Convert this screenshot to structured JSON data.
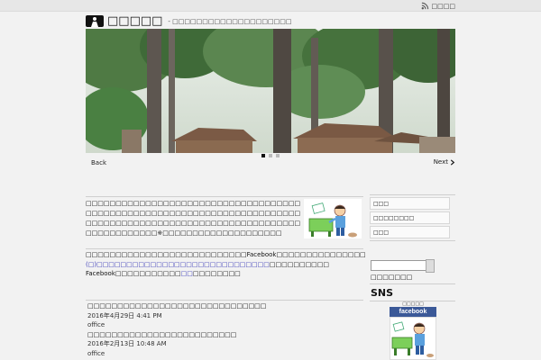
{
  "topbar": {
    "rss_label": "□□□□"
  },
  "header": {
    "site_title": "□□□□□",
    "tagline": "- □□□□□□□□□□□□□□□□□□□□"
  },
  "slider": {
    "back_label": "Back",
    "next_label": "Next",
    "dots": 3,
    "active_dot": 0
  },
  "intro": {
    "text": "□□□□□□□□□□□□□□□□□□□□□□□□□□□□□□□□□□□□□□□□□□□□□□□□□□□□□□□□□□□□□□□□□□□□□□□□□□□□□□□□□□□□□□□□□□□□□□□□□□□□□□□□□□□□□□□□□□□□□□□□※□□□□□□□□□□□□□□□□□□□□"
  },
  "notice": {
    "line1": "□□□□□□□□□□□□□□□□□□□□□□□□□□□Facebook□□□□□□□□□□□□□□□",
    "line2_prefix": "(□)",
    "line2_link": "□□□□□□□□□□□□□□□□□□□□□□□□□□□□□",
    "line2_suffix": "□□□□□□□□□□",
    "line3_prefix": "Facebook□□□□□□□□□□□",
    "line3_link": "□□",
    "line3_suffix": "□□□□□□□□"
  },
  "posts": [
    {
      "title": "□□□□□□□□□□□□□□□□□□□□□□□□□□□□□□",
      "date": "2016年4月29日 4:41 PM",
      "author": "office"
    },
    {
      "title": "□□□□□□□□□□□□□□□□□□□□□□□□□",
      "date": "2016年2月13日 10:48 AM",
      "author": "office"
    }
  ],
  "sidebar": {
    "menu": [
      "□□□",
      "□□□□□□□□",
      "□□□"
    ],
    "search_label": "□□□□□□□",
    "sns_title": "SNS",
    "fb_caption": "□□□□□",
    "fb_label": "facebook"
  }
}
